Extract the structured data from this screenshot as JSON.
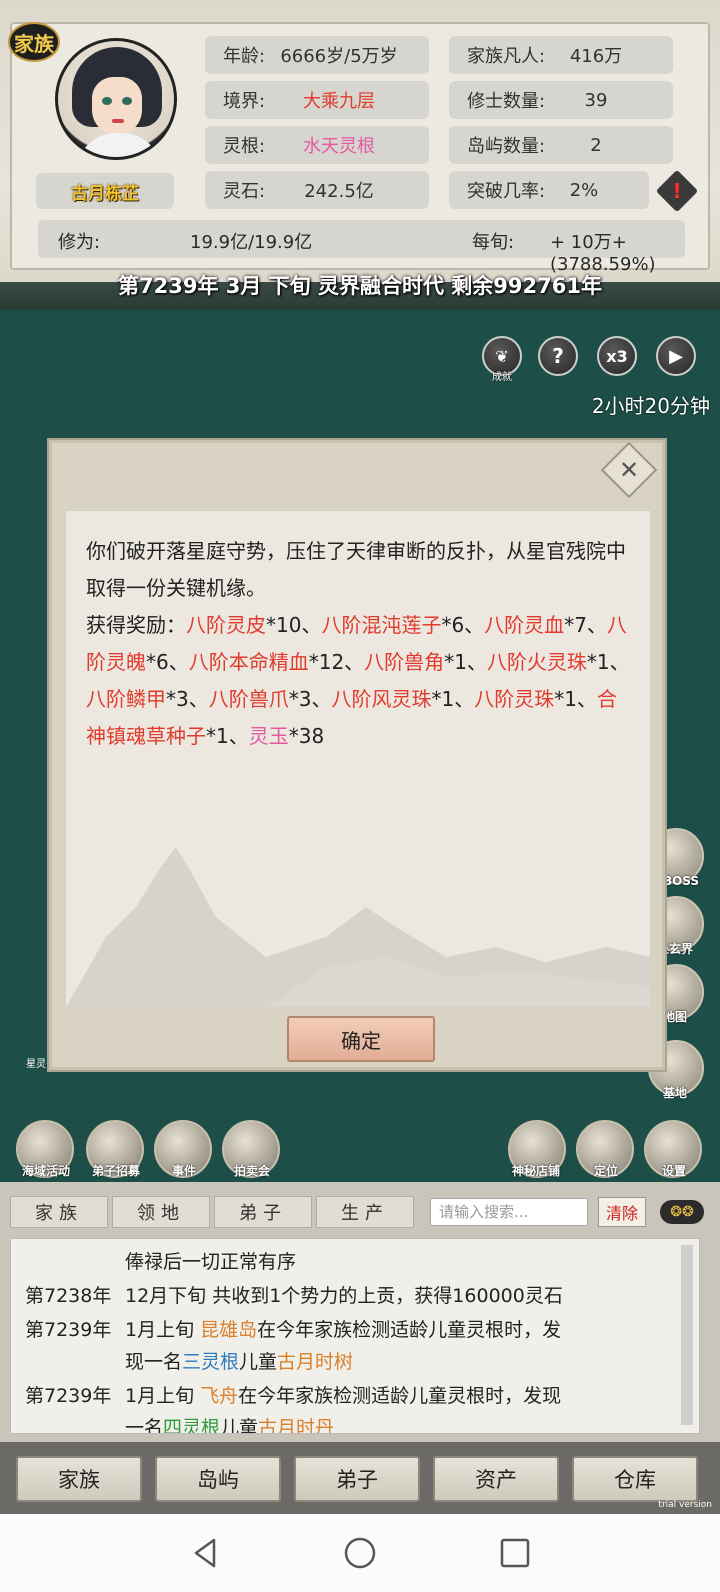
{
  "header": {
    "family_badge": "家族",
    "character_name": "古月栋芷",
    "stats_left": [
      {
        "label": "年龄:",
        "value": "6666岁/5万岁",
        "color": ""
      },
      {
        "label": "境界:",
        "value": "大乘九层",
        "color": "red"
      },
      {
        "label": "灵根:",
        "value": "水天灵根",
        "color": "pink"
      },
      {
        "label": "灵石:",
        "value": "242.5亿",
        "color": ""
      }
    ],
    "stats_right": [
      {
        "label": "家族凡人:",
        "value": "416万"
      },
      {
        "label": "修士数量:",
        "value": "39"
      },
      {
        "label": "岛屿数量:",
        "value": "2"
      },
      {
        "label": "突破几率:",
        "value": "2%"
      }
    ],
    "cultivation_label": "修为:",
    "cultivation_value": "19.9亿/19.9亿",
    "per_period_label": "每旬:",
    "per_period_value": "+ 10万+(3788.59%)",
    "date_line": "第7239年 3月 下旬  灵界融合时代 剩余992761年"
  },
  "controls": {
    "achievement_label": "成就",
    "help_label": "?",
    "speed_label": "x3",
    "play_label": "▶",
    "time_remaining": "2小时20分钟"
  },
  "side_icons": [
    {
      "label": "界BOSS",
      "icon": "demon-icon"
    },
    {
      "label": "上玄界",
      "icon": "mountain-icon"
    },
    {
      "label": "地图",
      "icon": "map-pin-icon"
    },
    {
      "label": "基地",
      "icon": "base-icon"
    }
  ],
  "left_side_label": "星灵",
  "dialog": {
    "line1": "你们破开落星庭守势，压住了天律审断的反扑，从星官残院中取得一份关键机缘。",
    "reward_prefix": "获得奖励：",
    "rewards": [
      {
        "name": "八阶灵皮",
        "qty": "*10",
        "sep": "、",
        "color": "r"
      },
      {
        "name": "八阶混沌莲子",
        "qty": "*6",
        "sep": "、",
        "color": "r"
      },
      {
        "name": "八阶灵血",
        "qty": "*7",
        "sep": "、",
        "color": "r"
      },
      {
        "name": "八阶灵魄",
        "qty": "*6",
        "sep": "、",
        "color": "r"
      },
      {
        "name": "八阶本命精血",
        "qty": "*12",
        "sep": "、",
        "color": "r"
      },
      {
        "name": "八阶兽角",
        "qty": "*1",
        "sep": "、",
        "color": "r"
      },
      {
        "name": "八阶火灵珠",
        "qty": "*1",
        "sep": "、",
        "color": "r"
      },
      {
        "name": "八阶鳞甲",
        "qty": "*3",
        "sep": "、",
        "color": "r"
      },
      {
        "name": "八阶兽爪",
        "qty": "*3",
        "sep": "、",
        "color": "r"
      },
      {
        "name": "八阶风灵珠",
        "qty": "*1",
        "sep": "、",
        "color": "r"
      },
      {
        "name": "八阶灵珠",
        "qty": "*1",
        "sep": "、",
        "color": "r"
      },
      {
        "name": "合神镇魂草种子",
        "qty": "*1",
        "sep": "、",
        "color": "r"
      },
      {
        "name": "灵玉",
        "qty": "*38",
        "sep": "",
        "color": "p"
      }
    ],
    "confirm": "确定"
  },
  "bottom_icons": [
    {
      "label": "海域活动",
      "icon": "sea-event-icon"
    },
    {
      "label": "弟子招募",
      "icon": "recruit-icon"
    },
    {
      "label": "事件",
      "icon": "scroll-icon"
    },
    {
      "label": "拍卖会",
      "icon": "gavel-icon"
    },
    {
      "label": "神秘店铺",
      "icon": "shop-icon"
    },
    {
      "label": "定位",
      "icon": "locate-icon"
    },
    {
      "label": "设置",
      "icon": "gear-icon"
    }
  ],
  "log_tabs": [
    "家族",
    "领地",
    "弟子",
    "生产"
  ],
  "search": {
    "placeholder": "请输入搜索..."
  },
  "clear_label": "清除",
  "log": {
    "line0": "俸禄后一切正常有序",
    "l1_date": "第7238年",
    "l1_text": "12月下旬 共收到1个势力的上贡，获得160000灵石",
    "l2_date": "第7239年",
    "l2_pre": "1月上旬 ",
    "l2_place": "昆雄岛",
    "l2_mid": "在今年家族检测适龄儿童灵根时，发",
    "l2b_pre": "现一名",
    "l2b_root": "三灵根",
    "l2b_mid": "儿童",
    "l2b_name": "古月时树",
    "l3_date": "第7239年",
    "l3_pre": "1月上旬 ",
    "l3_place": "飞舟",
    "l3_mid": "在今年家族检测适龄儿童灵根时，发现",
    "l3b_pre": "一名",
    "l3b_root": "四灵根",
    "l3b_mid": "儿童",
    "l3b_name": "古月时丹"
  },
  "bottom_nav": [
    "家族",
    "岛屿",
    "弟子",
    "资产",
    "仓库"
  ],
  "trial": "trial version"
}
